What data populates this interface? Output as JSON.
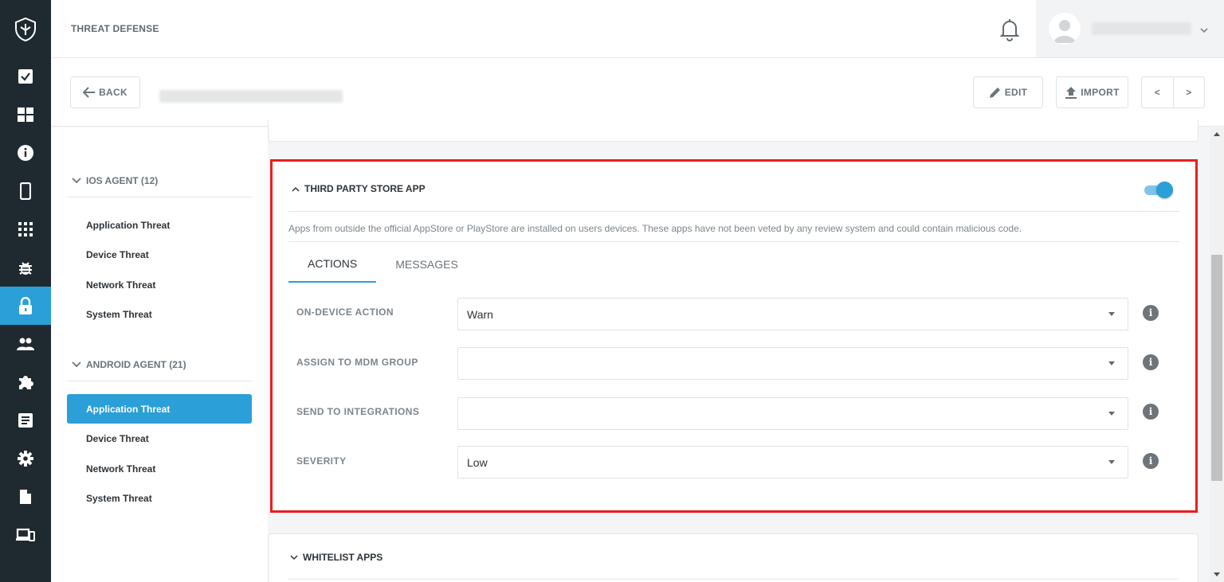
{
  "header": {
    "title": "THREAT DEFENSE"
  },
  "actionbar": {
    "back_label": "BACK",
    "edit_label": "EDIT",
    "import_label": "IMPORT",
    "prev_label": "<",
    "next_label": ">"
  },
  "tree": {
    "groups": [
      {
        "label": "IOS AGENT (12)",
        "items": [
          "Application Threat",
          "Device Threat",
          "Network Threat",
          "System Threat"
        ]
      },
      {
        "label": "ANDROID AGENT (21)",
        "items": [
          "Application Threat",
          "Device Threat",
          "Network Threat",
          "System Threat"
        ]
      }
    ],
    "selected": "ANDROID AGENT (21) / Application Threat"
  },
  "policy": {
    "title": "THIRD PARTY STORE APP",
    "enabled": true,
    "description": "Apps from outside the official AppStore or PlayStore are installed on users devices. These apps have not been veted by any review system and could contain malicious code.",
    "tabs": [
      "ACTIONS",
      "MESSAGES"
    ],
    "active_tab": "ACTIONS",
    "fields": [
      {
        "label": "ON-DEVICE ACTION",
        "value": "Warn"
      },
      {
        "label": "ASSIGN TO MDM GROUP",
        "value": ""
      },
      {
        "label": "SEND TO INTEGRATIONS",
        "value": ""
      },
      {
        "label": "SEVERITY",
        "value": "Low"
      }
    ]
  },
  "next_policy": {
    "title": "WHITELIST APPS"
  },
  "colors": {
    "rail_bg": "#1f2a30",
    "accent": "#2a9fd8",
    "highlight_border": "#ee1c1c"
  },
  "icons": {
    "rail": [
      "shield-logo-icon",
      "checkbox-icon",
      "dashboard-icon",
      "info-icon",
      "mobile-device-icon",
      "apps-grid-icon",
      "bug-icon",
      "lock-icon",
      "users-icon",
      "puzzle-icon",
      "list-icon",
      "settings-icon",
      "document-icon",
      "devices-icon"
    ],
    "header": [
      "bell-icon",
      "avatar-icon",
      "chevron-down-icon"
    ]
  }
}
